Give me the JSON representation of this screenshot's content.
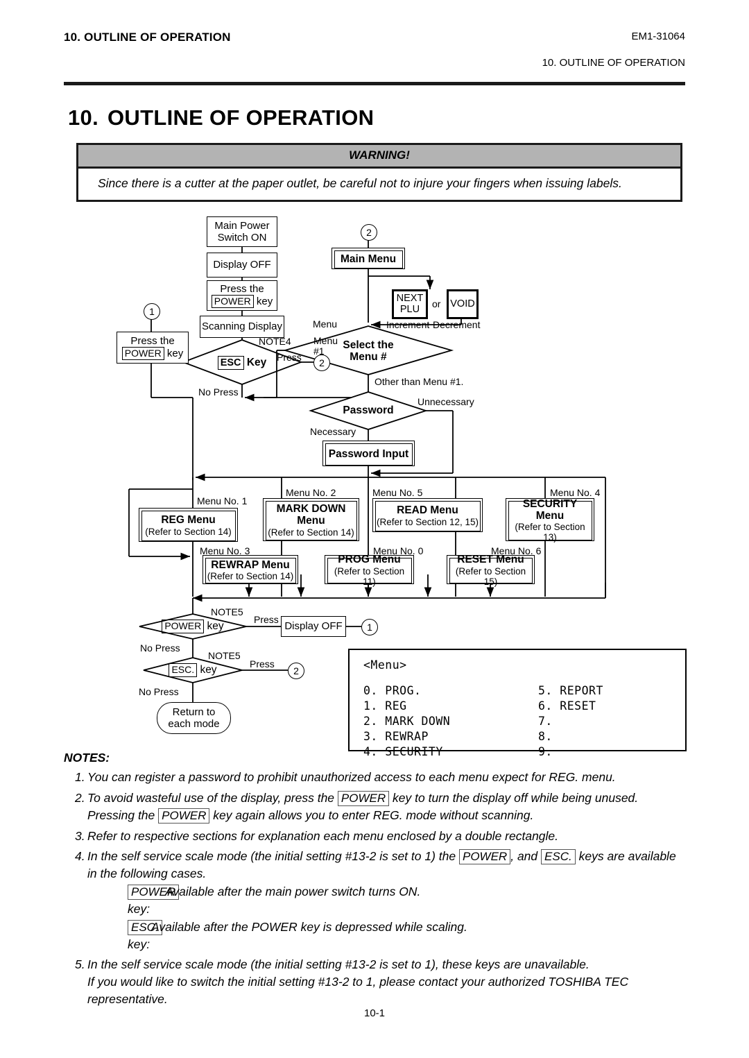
{
  "header": {
    "left": "10. OUTLINE OF OPERATION",
    "code": "EM1-31064",
    "right": "10. OUTLINE OF OPERATION"
  },
  "title": {
    "number": "10.",
    "text": "OUTLINE OF OPERATION"
  },
  "warning": {
    "heading": "WARNING!",
    "body": "Since there is a cutter at the paper outlet, be careful not to injure your fingers when issuing labels."
  },
  "flow": {
    "main_power_switch_on": "Main Power\nSwitch ON",
    "display_off_top": "Display OFF",
    "press_power_key_1": "Press the",
    "press_power_key_1_key": "POWER",
    "press_power_key_1_suffix": "key",
    "scanning_display": "Scanning Display",
    "press_the": "Press the",
    "power_key_label": "POWER",
    "key_word": "key",
    "esc_key_cap": "ESC",
    "esc_key_word": "Key",
    "esc_dot_cap": "ESC.",
    "main_menu": "Main Menu",
    "next_plu": "NEXT\nPLU",
    "or": "or",
    "void": "VOID",
    "increment": "Increment",
    "decrement": "Decrement",
    "select_the_menu": "Select the\nMenu #",
    "password": "Password",
    "password_input": "Password Input",
    "display_off_bottom": "Display OFF",
    "return_to_each_mode": "Return to\neach mode",
    "labels": {
      "note4": "NOTE4",
      "note5_a": "NOTE5",
      "note5_b": "NOTE5",
      "press_a": "Press",
      "press_b": "Press",
      "press_c": "Press",
      "no_press_a": "No Press",
      "no_press_b": "No Press",
      "no_press_c": "No Press",
      "menu_hash1_l1": "Menu",
      "menu_hash1_l2": "#1",
      "other_than_menu1": "Other than Menu #1.",
      "unnecessary": "Unnecessary",
      "necessary": "Necessary",
      "menu_word": "Menu"
    },
    "circles": {
      "one_a": "1",
      "one_b": "1",
      "two_a": "2",
      "two_b": "2",
      "two_c": "2"
    },
    "menus": [
      {
        "no": "Menu No. 1",
        "title": "REG Menu",
        "ref": "(Refer to Section 14)"
      },
      {
        "no": "Menu No. 2",
        "title": "MARK DOWN\nMenu",
        "ref": "(Refer to Section 14)"
      },
      {
        "no": "Menu No. 5",
        "title": "READ Menu",
        "ref": "(Refer to Section 12, 15)"
      },
      {
        "no": "Menu No. 4",
        "title": "SECURITY\nMenu",
        "ref": "(Refer to Section 13)"
      },
      {
        "no": "Menu No. 3",
        "title": "REWRAP Menu",
        "ref": "(Refer to Section 14)"
      },
      {
        "no": "Menu No. 0",
        "title": "PROG Menu",
        "ref": "(Refer to Section 11)"
      },
      {
        "no": "Menu No. 6",
        "title": "RESET Menu",
        "ref": "(Refer to Section 15)"
      }
    ]
  },
  "lcd": {
    "header": "<Menu>",
    "left_lines": "0. PROG.\n1. REG\n2. MARK DOWN\n3. REWRAP\n4. SECURITY",
    "right_lines": "5. REPORT\n6. RESET\n7.\n8.\n9."
  },
  "notes": {
    "title": "NOTES:",
    "n1": "1.",
    "t1": "You can register a password to prohibit unauthorized access to each menu expect for REG. menu.",
    "n2": "2.",
    "t2a": "To avoid wasteful use of the display, press the",
    "t2key1": "POWER",
    "t2b": "key to turn the display off while being unused.  Pressing the",
    "t2key2": "POWER",
    "t2c": "key again allows you to enter REG. mode without scanning.",
    "n3": "3.",
    "t3": "Refer to respective sections for explanation each menu enclosed by a double rectangle.",
    "n4": "4.",
    "t4a": "In the self service scale mode (the initial setting #13-2 is set to 1) the",
    "t4key1": "POWER",
    "t4b": ", and",
    "t4key2": "ESC.",
    "t4c": "keys are available in the following cases.",
    "sub1key": "POWER",
    "sub1label": "key:",
    "sub1text": "Available after the main power switch turns ON.",
    "sub2key": "ESC.",
    "sub2label": "key:",
    "sub2text": "Available after the  POWER  key is depressed while scaling.",
    "n5": "5.",
    "t5": "In the self service scale mode (the initial setting #13-2 is set to 1), these keys are unavailable.",
    "t5b": "If you would like to switch the initial setting #13-2 to 1, please contact your authorized TOSHIBA TEC representative."
  },
  "page_number": "10-1"
}
